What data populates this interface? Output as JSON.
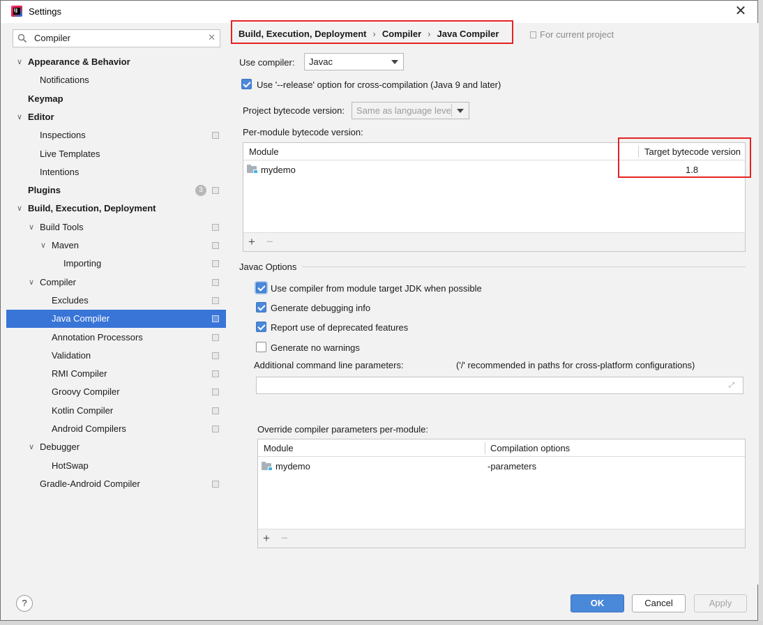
{
  "window": {
    "title": "Settings"
  },
  "search": {
    "value": "Compiler"
  },
  "sidebar": {
    "items": [
      {
        "label": "Appearance & Behavior",
        "bold": true,
        "arrow": "down",
        "level": 0
      },
      {
        "label": "Notifications",
        "level": 1
      },
      {
        "label": "Keymap",
        "bold": true,
        "level": 0
      },
      {
        "label": "Editor",
        "bold": true,
        "arrow": "down",
        "level": 0
      },
      {
        "label": "Inspections",
        "level": 1,
        "project": true
      },
      {
        "label": "Live Templates",
        "level": 1
      },
      {
        "label": "Intentions",
        "level": 1
      },
      {
        "label": "Plugins",
        "bold": true,
        "level": 0,
        "badge": "3",
        "project": true
      },
      {
        "label": "Build, Execution, Deployment",
        "bold": true,
        "arrow": "down",
        "level": 0
      },
      {
        "label": "Build Tools",
        "arrow": "down",
        "level": 1,
        "project": true
      },
      {
        "label": "Maven",
        "arrow": "down",
        "level": 2,
        "project": true
      },
      {
        "label": "Importing",
        "level": 3,
        "project": true
      },
      {
        "label": "Compiler",
        "arrow": "down",
        "level": 1,
        "project": true
      },
      {
        "label": "Excludes",
        "level": 2,
        "project": true
      },
      {
        "label": "Java Compiler",
        "level": 2,
        "project": true,
        "selected": true
      },
      {
        "label": "Annotation Processors",
        "level": 2,
        "project": true
      },
      {
        "label": "Validation",
        "level": 2,
        "project": true
      },
      {
        "label": "RMI Compiler",
        "level": 2,
        "project": true
      },
      {
        "label": "Groovy Compiler",
        "level": 2,
        "project": true
      },
      {
        "label": "Kotlin Compiler",
        "level": 2,
        "project": true
      },
      {
        "label": "Android Compilers",
        "level": 2,
        "project": true
      },
      {
        "label": "Debugger",
        "arrow": "down",
        "level": 1
      },
      {
        "label": "HotSwap",
        "level": 2
      },
      {
        "label": "Gradle-Android Compiler",
        "level": 1,
        "project": true
      }
    ]
  },
  "breadcrumb": {
    "parts": [
      "Build, Execution, Deployment",
      "Compiler",
      "Java Compiler"
    ],
    "separator": "›",
    "for_current": "For current project"
  },
  "compiler": {
    "use_compiler_label": "Use compiler:",
    "use_compiler_value": "Javac",
    "release_option_label": "Use '--release' option for cross-compilation (Java 9 and later)",
    "release_option_checked": true,
    "project_bytecode_label": "Project bytecode version:",
    "project_bytecode_placeholder": "Same as language leve",
    "per_module_label": "Per-module bytecode version:"
  },
  "bytecode_table": {
    "headers": [
      "Module",
      "Target bytecode version"
    ],
    "rows": [
      {
        "module": "mydemo",
        "version": "1.8"
      }
    ],
    "add": "+",
    "remove": "−"
  },
  "javac_options": {
    "title": "Javac Options",
    "checkboxes": [
      {
        "label": "Use compiler from module target JDK when possible",
        "checked": true
      },
      {
        "label": "Generate debugging info",
        "checked": true
      },
      {
        "label": "Report use of deprecated features",
        "checked": true
      },
      {
        "label": "Generate no warnings",
        "checked": false
      }
    ],
    "additional_label": "Additional command line parameters:",
    "additional_hint": "('/' recommended in paths for cross-platform configurations)",
    "additional_value": "",
    "override_label": "Override compiler parameters per-module:"
  },
  "override_table": {
    "headers": [
      "Module",
      "Compilation options"
    ],
    "rows": [
      {
        "module": "mydemo",
        "options": "-parameters"
      }
    ],
    "add": "+",
    "remove": "−"
  },
  "footer": {
    "help": "?",
    "ok": "OK",
    "cancel": "Cancel",
    "apply": "Apply"
  },
  "colors": {
    "accent": "#4a88d9",
    "selection": "#3875d7",
    "highlight_border": "#e52222"
  }
}
